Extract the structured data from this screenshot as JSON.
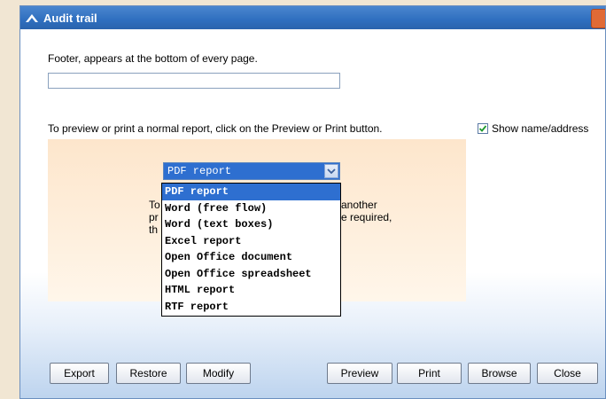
{
  "window": {
    "title": "Audit trail"
  },
  "footer": {
    "label": "Footer, appears at the bottom of every page.",
    "value": ""
  },
  "preview_hint": "To preview or print a normal report, click on the Preview or Print button.",
  "show_name_address": {
    "label": "Show name/address",
    "checked": true
  },
  "export_format": {
    "selected": "PDF report",
    "options": [
      "PDF report",
      "Word (free flow)",
      "Word (text boxes)",
      "Excel report",
      "Open Office document",
      "Open Office spreadsheet",
      "HTML report",
      "RTF report"
    ]
  },
  "export_hint": {
    "line1_start": "To",
    "line1_end": "another",
    "line2_start": "pr",
    "line2_end": "e required,",
    "line3_start": "th"
  },
  "buttons": {
    "export": "Export",
    "restore": "Restore",
    "modify": "Modify",
    "preview": "Preview",
    "print": "Print",
    "browse": "Browse",
    "close": "Close"
  }
}
